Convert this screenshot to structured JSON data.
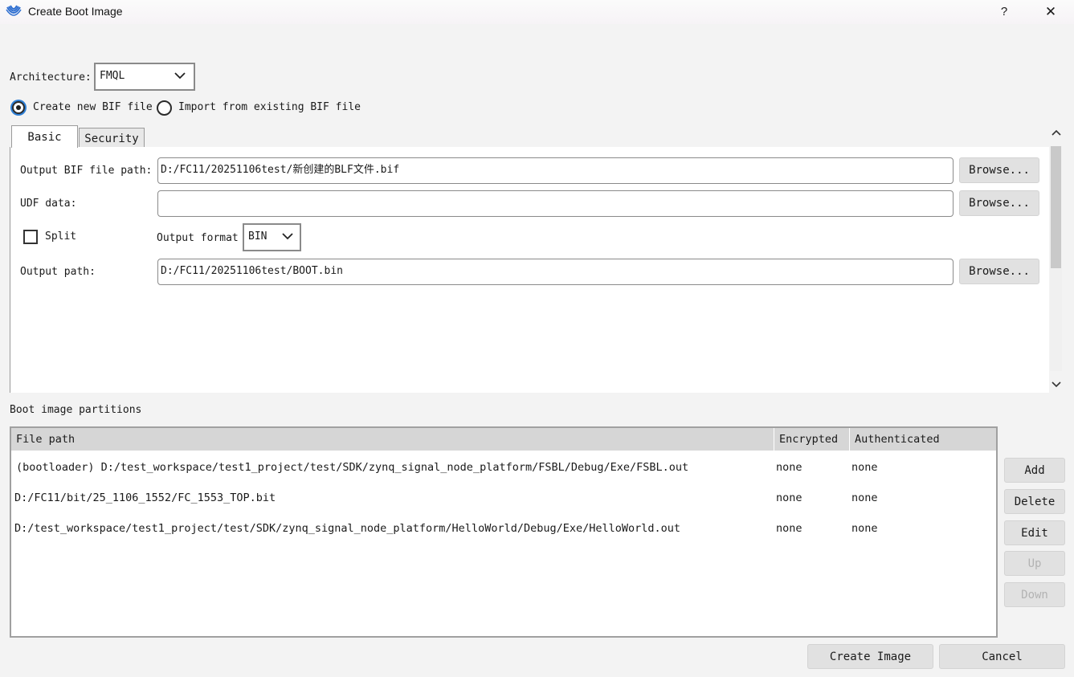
{
  "window": {
    "title": "Create Boot Image",
    "help": "?",
    "close": "✕"
  },
  "architecture": {
    "label": "Architecture:",
    "value": "FMQL"
  },
  "bif_mode": {
    "create_label": "Create new BIF file",
    "import_label": "Import from existing BIF file",
    "selected": "create"
  },
  "tabs": [
    {
      "label": "Basic"
    },
    {
      "label": "Security"
    }
  ],
  "basic": {
    "output_bif_label": "Output BIF file path:",
    "output_bif_value": "D:/FC11/20251106test/新创建的BLF文件.bif",
    "udf_label": "UDF data:",
    "udf_value": "",
    "split_label": "Split",
    "split_checked": false,
    "output_format_label": "Output format",
    "output_format_value": "BIN",
    "output_path_label": "Output path:",
    "output_path_value": "D:/FC11/20251106test/BOOT.bin",
    "browse_label": "Browse..."
  },
  "partitions": {
    "label": "Boot image partitions",
    "columns": [
      "File path",
      "Encrypted",
      "Authenticated"
    ],
    "rows": [
      {
        "path": "(bootloader) D:/test_workspace/test1_project/test/SDK/zynq_signal_node_platform/FSBL/Debug/Exe/FSBL.out",
        "encrypted": "none",
        "authenticated": "none"
      },
      {
        "path": "D:/FC11/bit/25_1106_1552/FC_1553_TOP.bit",
        "encrypted": "none",
        "authenticated": "none"
      },
      {
        "path": "D:/test_workspace/test1_project/test/SDK/zynq_signal_node_platform/HelloWorld/Debug/Exe/HelloWorld.out",
        "encrypted": "none",
        "authenticated": "none"
      }
    ],
    "buttons": {
      "add": "Add",
      "delete": "Delete",
      "edit": "Edit",
      "up": "Up",
      "down": "Down"
    }
  },
  "footer": {
    "create": "Create Image",
    "cancel": "Cancel"
  },
  "colors": {
    "accent": "#2d7fd6",
    "icon_blue": "#2f6fd0",
    "header_bg": "#d6d6d6",
    "button_bg": "#e1e1e1"
  },
  "icons": [
    "app-logo-icon",
    "chevron-down-icon",
    "chevron-up-icon",
    "close-icon",
    "help-icon"
  ]
}
